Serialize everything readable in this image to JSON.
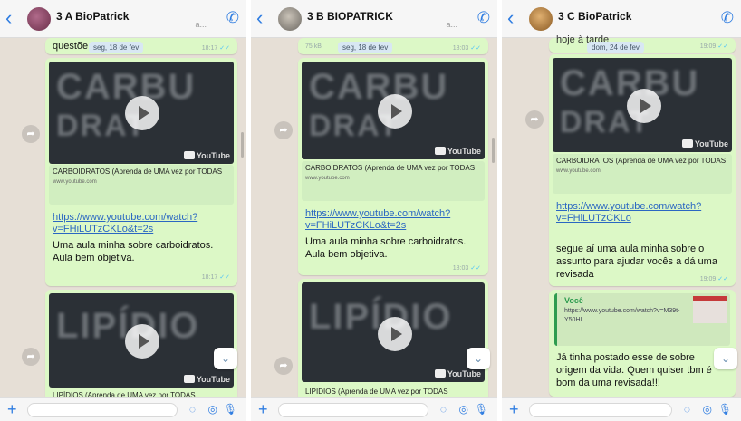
{
  "panels": [
    {
      "title": "3 A BioPatrick",
      "date": "seg, 18 de fev",
      "top_partial_text": "questõe",
      "top_time": "18:17",
      "video1": {
        "thumb_word1": "CARBU",
        "thumb_word2": "DRAT",
        "link_title": "CARBOIDRATOS (Aprenda de UMA vez por TODAS",
        "domain": "www.youtube.com"
      },
      "link": "https://www.youtube.com/watch?v=FHiLUTzCKLo&t=2s",
      "text": "Uma aula minha sobre carboidratos. Aula bem objetiva.",
      "time": "18:17",
      "video2": {
        "thumb_word": "LIPÍDIO",
        "link_title": "LIPÍDIOS (Aprenda de UMA vez por TODAS"
      }
    },
    {
      "title": "3 B BIOPATRICK",
      "date": "seg, 18 de fev",
      "top_partial_text": "75 kB",
      "top_time": "18:03",
      "video1": {
        "thumb_word1": "CARBU",
        "thumb_word2": "DRAT",
        "link_title": "CARBOIDRATOS (Aprenda de UMA vez por TODAS",
        "domain": "www.youtube.com"
      },
      "link": "https://www.youtube.com/watch?v=FHiLUTzCKLo&t=2s",
      "text": "Uma aula minha sobre carboidratos. Aula bem objetiva.",
      "time": "18:03",
      "video2": {
        "thumb_word": "LIPÍDIO",
        "link_title": "LIPÍDIOS (Aprenda de UMA vez por TODAS"
      }
    },
    {
      "title": "3 C BioPatrick",
      "date": "dom, 24 de fev",
      "top_partial_text": "hoje à tarde",
      "top_time": "19:09",
      "video1": {
        "thumb_word1": "CARBU",
        "thumb_word2": "DRAT",
        "link_title": "CARBOIDRATOS (Aprenda de UMA vez por TODAS",
        "domain": "www.youtube.com"
      },
      "link": "https://www.youtube.com/watch?v=FHiLUTzCKLo",
      "text": "segue aí uma aula minha sobre o assunto para ajudar vocês a dá uma revisada",
      "time": "19:09",
      "quote": {
        "author": "Você",
        "text": "https://www.youtube.com/watch?v=M39t-Y50HI"
      },
      "reply_text": "Já tinha postado esse de sobre origem da vida. Quem quiser tbm é bom da uma revisada!!!"
    }
  ]
}
